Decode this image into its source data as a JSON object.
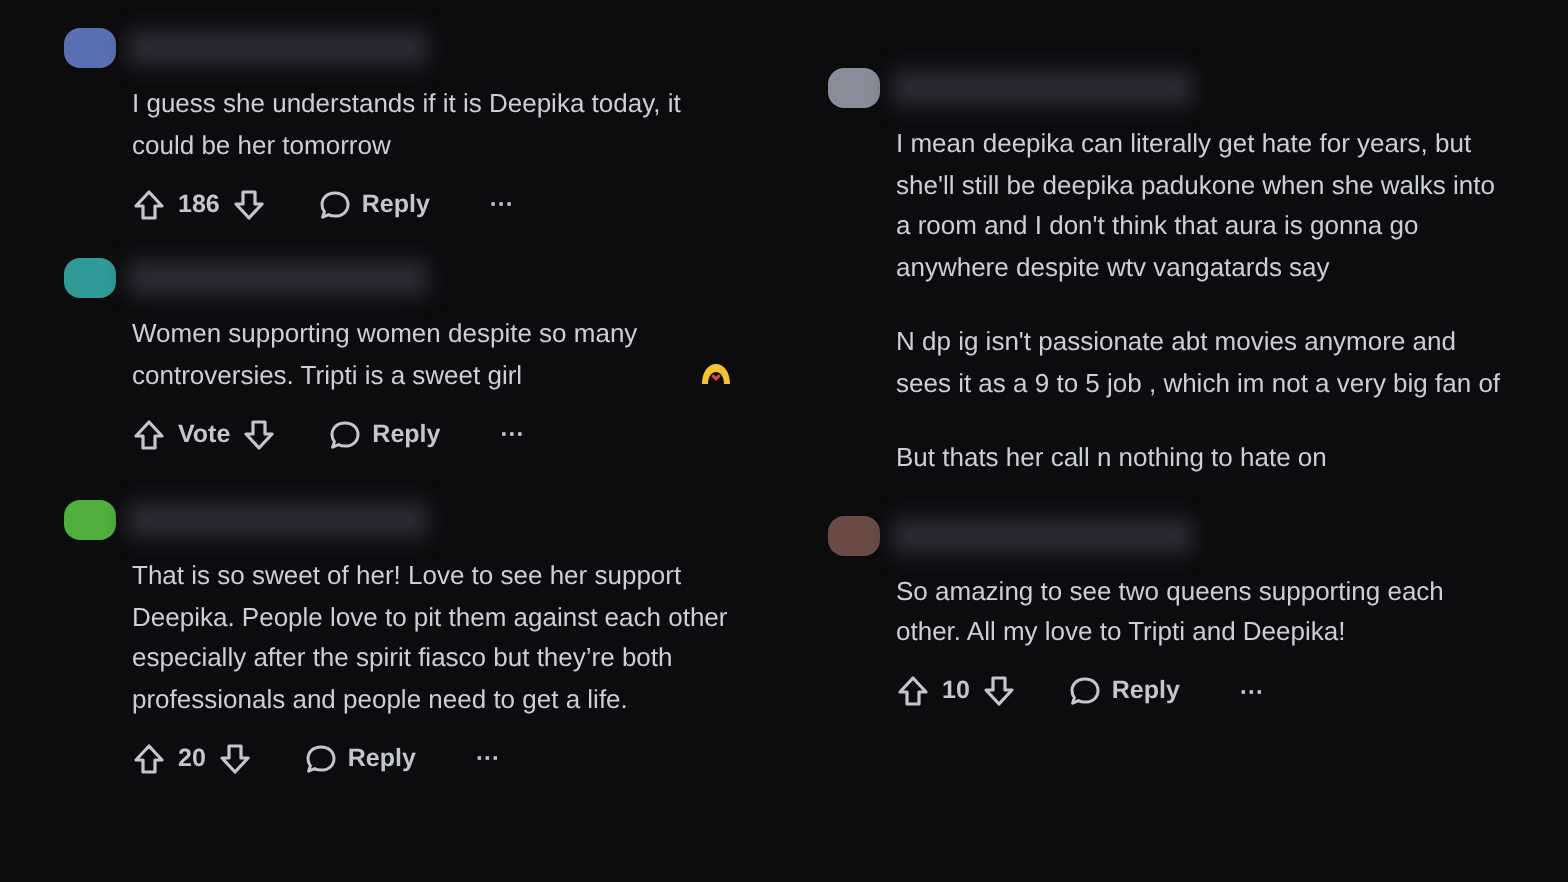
{
  "columns": [
    {
      "comments": [
        {
          "color": "#5a6fb0",
          "paragraphs": [
            "I guess she understands if it is Deepika today, it could be her tomorrow"
          ],
          "has_emoji": false,
          "actions": {
            "score": "186",
            "reply": "Reply",
            "more": "···"
          }
        },
        {
          "color": "#2f9a96",
          "paragraphs": [
            "Women supporting women despite so many controversies. Tripti is a sweet girl"
          ],
          "has_emoji": true,
          "actions": {
            "score": "Vote",
            "reply": "Reply",
            "more": "···"
          }
        },
        {
          "color": "#4fae3c",
          "paragraphs": [
            "That is so sweet of her! Love to see her support Deepika. People love to pit them against each other especially after the spirit fiasco but they’re both professionals and people need to get a life."
          ],
          "has_emoji": false,
          "actions": {
            "score": "20",
            "reply": "Reply",
            "more": "···"
          }
        }
      ]
    },
    {
      "comments": [
        {
          "color": "#8a8d99",
          "paragraphs": [
            "I mean deepika can literally get hate for years, but she'll still be deepika padukone when she walks into a room and I don't think that aura is gonna go anywhere despite wtv vangatards say",
            "N dp ig isn't passionate abt movies anymore and sees it as a 9 to 5 job , which im not a very big fan of",
            "But thats her call n nothing to hate on"
          ],
          "has_emoji": false
        },
        {
          "color": "#6a4a44",
          "paragraphs": [
            "So amazing to see two queens supporting each other. All my love to Tripti and Deepika!"
          ],
          "has_emoji": false,
          "actions": {
            "score": "10",
            "reply": "Reply",
            "more": "···"
          }
        }
      ]
    }
  ]
}
